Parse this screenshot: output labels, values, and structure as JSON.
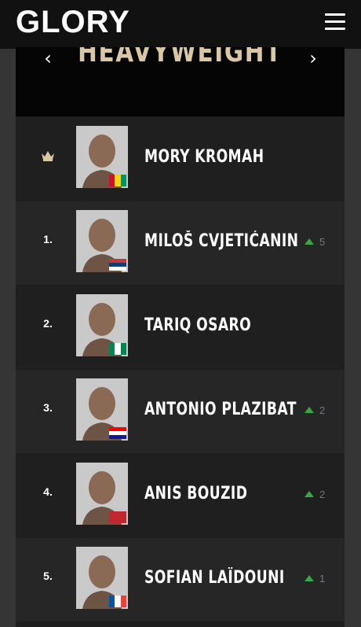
{
  "brand": {
    "logo": "GLORY"
  },
  "division": {
    "title": "HEAVYWEIGHT",
    "prev_arrow": "‹",
    "next_arrow": "›"
  },
  "fighters": [
    {
      "rank": "",
      "champion": true,
      "name": "MORY KROMAH",
      "movement": "",
      "flag_colors": [
        "#ce1126",
        "#fcd116",
        "#009460"
      ]
    },
    {
      "rank": "1.",
      "champion": false,
      "name": "MILOŠ CVJETIĆANIN",
      "movement": "5",
      "flag_colors": [
        "#c6363c",
        "#0c4076",
        "#ffffff"
      ]
    },
    {
      "rank": "2.",
      "champion": false,
      "name": "TARIQ OSARO",
      "movement": "",
      "flag_colors": [
        "#008751",
        "#ffffff",
        "#008751"
      ]
    },
    {
      "rank": "3.",
      "champion": false,
      "name": "ANTONIO PLAZIBAT",
      "movement": "2",
      "flag_colors": [
        "#ff0000",
        "#ffffff",
        "#171796"
      ]
    },
    {
      "rank": "4.",
      "champion": false,
      "name": "ANIS BOUZID",
      "movement": "2",
      "flag_colors": [
        "#c1272d",
        "#c1272d",
        "#c1272d"
      ]
    },
    {
      "rank": "5.",
      "champion": false,
      "name": "SOFIAN LAÏDOUNI",
      "movement": "1",
      "flag_colors": [
        "#0055a4",
        "#ffffff",
        "#ef4135"
      ]
    }
  ]
}
